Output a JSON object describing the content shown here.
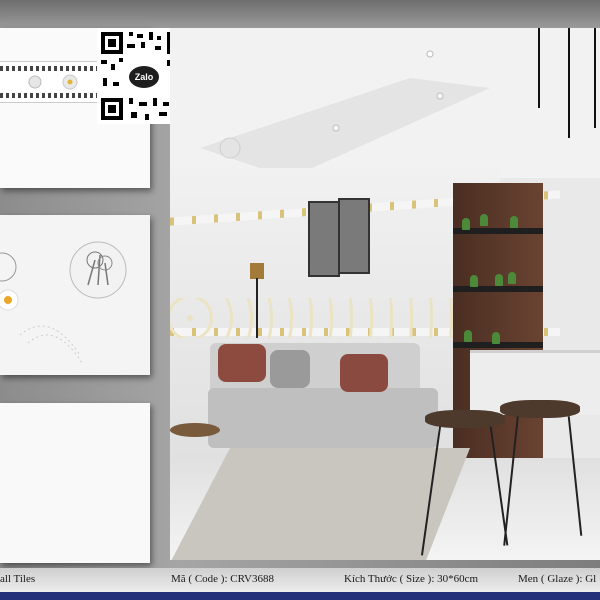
{
  "qr": {
    "badge_label": "Zalo"
  },
  "footer": {
    "series_label": "all Tiles",
    "code_label": "Mã ( Code ): CRV3688",
    "size_label": "Kích Thước ( Size ): 30*60cm",
    "glaze_label": "Men ( Glaze ): Gl"
  },
  "colors": {
    "footer_accent": "#24307a",
    "background_gray": "#8a8a8a",
    "wood_panel": "#5a3a2a"
  },
  "icons": [
    "qr-code-icon",
    "zalo-logo-icon"
  ]
}
